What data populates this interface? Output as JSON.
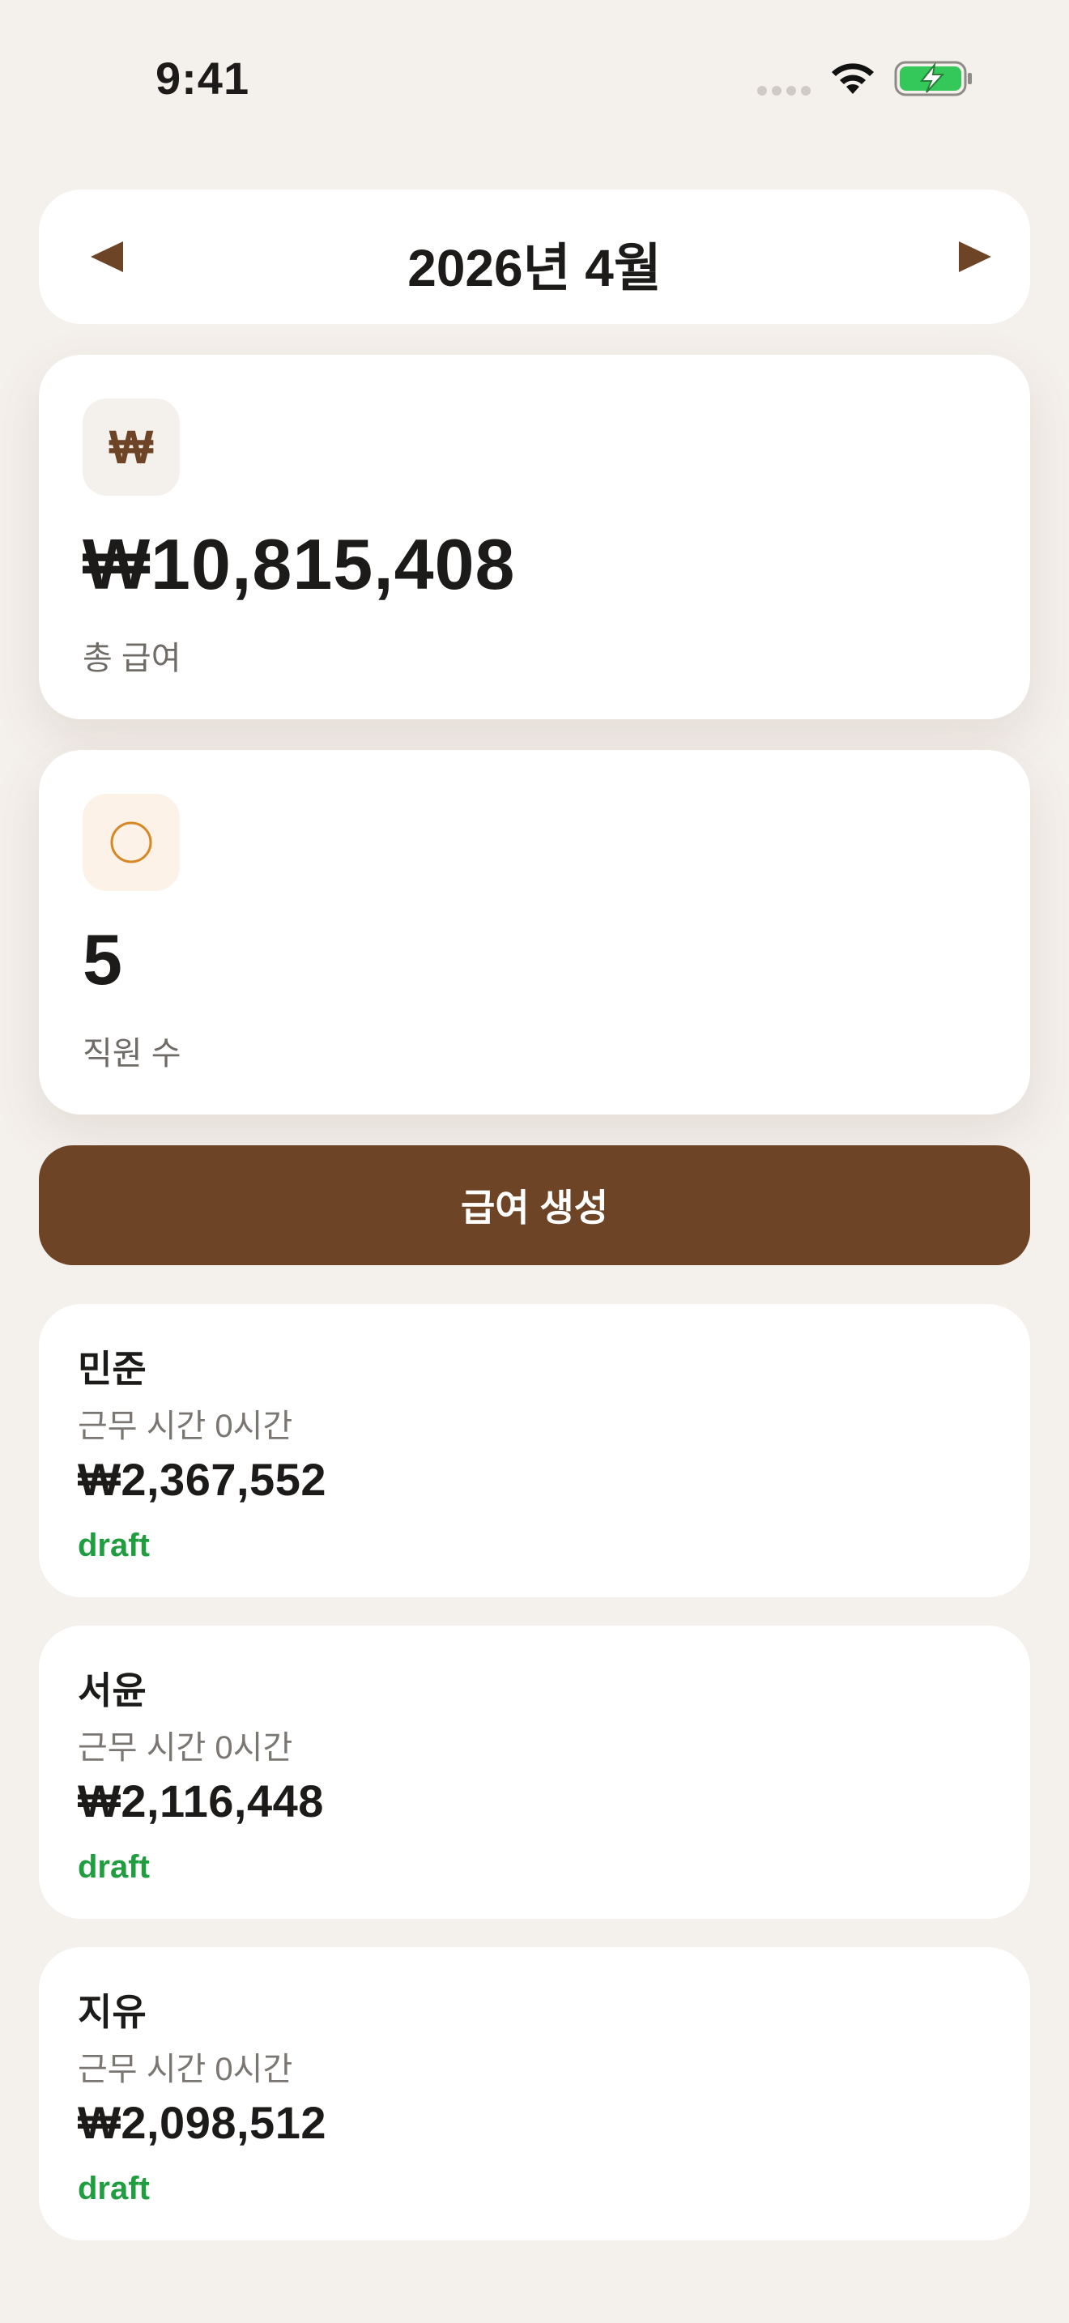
{
  "status_bar": {
    "time": "9:41",
    "icons": [
      "cellular-signal-icon",
      "wifi-icon",
      "battery-charging-icon"
    ]
  },
  "month_selector": {
    "title": "2026년 4월",
    "prev_icon": "triangle-left-icon",
    "next_icon": "triangle-right-icon"
  },
  "summary": {
    "total_pay": {
      "icon_glyph": "₩",
      "icon": "won-sign-icon",
      "value": "₩10,815,408",
      "label": "총 급여"
    },
    "employee_count": {
      "icon": "circle-outline-icon",
      "value": "5",
      "label": "직원 수"
    }
  },
  "generate_button": {
    "label": "급여 생성"
  },
  "employees": [
    {
      "name": "민준",
      "hours": "근무 시간 0시간",
      "amount": "₩2,367,552",
      "status": "draft"
    },
    {
      "name": "서윤",
      "hours": "근무 시간 0시간",
      "amount": "₩2,116,448",
      "status": "draft"
    },
    {
      "name": "지유",
      "hours": "근무 시간 0시간",
      "amount": "₩2,098,512",
      "status": "draft"
    }
  ],
  "colors": {
    "background": "#f4f0ec",
    "accent_brown": "#6e4426",
    "status_draft": "#1f9d3f",
    "circle_orange": "#d98624",
    "battery_green": "#34c759"
  }
}
